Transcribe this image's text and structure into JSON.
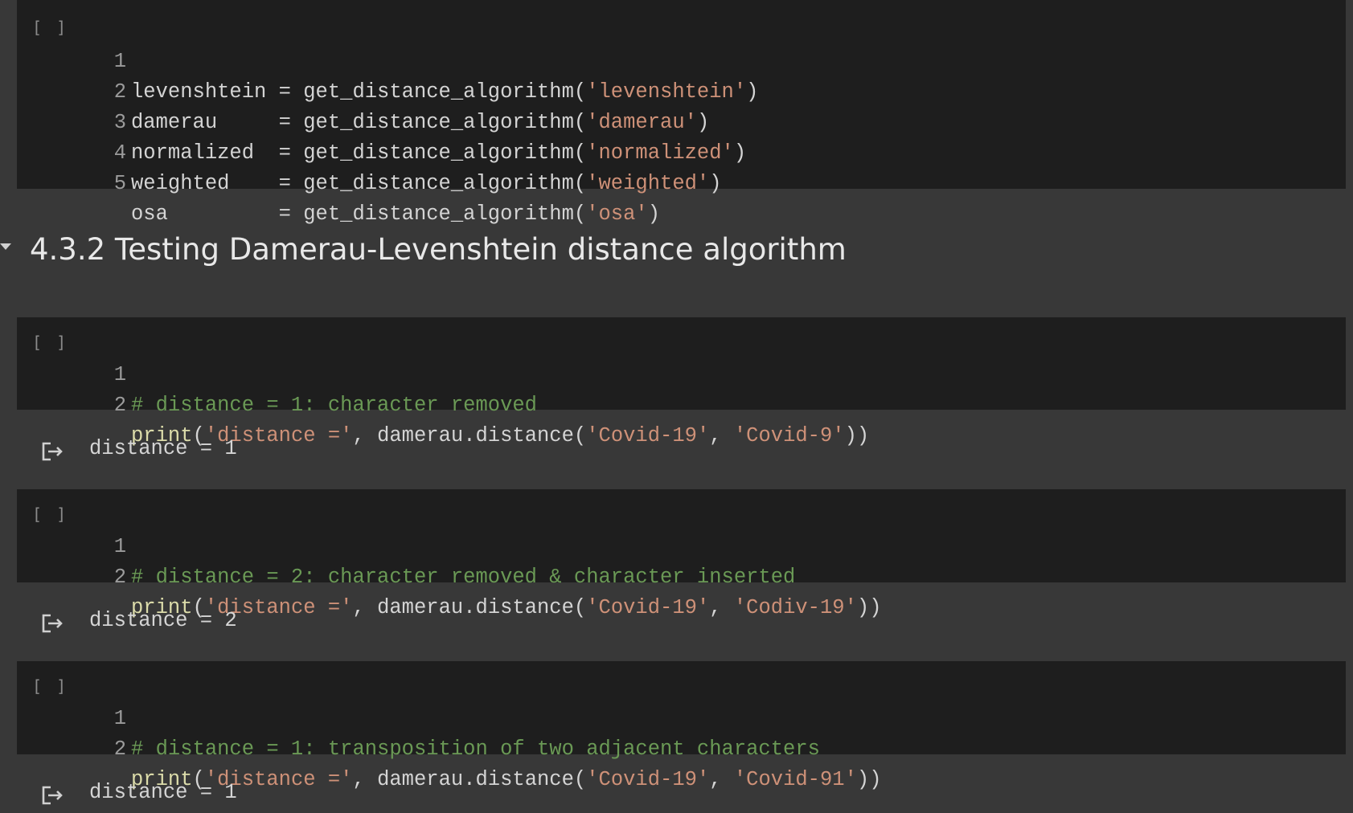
{
  "cells": [
    {
      "run_label": "[ ]",
      "lines": [
        {
          "n": "1",
          "parts": [
            {
              "t": "levenshtein = get_distance_algorithm(",
              "c": "plain"
            },
            {
              "t": "'levenshtein'",
              "c": "str"
            },
            {
              "t": ")",
              "c": "plain"
            }
          ]
        },
        {
          "n": "2",
          "parts": [
            {
              "t": "damerau     = get_distance_algorithm(",
              "c": "plain"
            },
            {
              "t": "'damerau'",
              "c": "str"
            },
            {
              "t": ")",
              "c": "plain"
            }
          ]
        },
        {
          "n": "3",
          "parts": [
            {
              "t": "normalized  = get_distance_algorithm(",
              "c": "plain"
            },
            {
              "t": "'normalized'",
              "c": "str"
            },
            {
              "t": ")",
              "c": "plain"
            }
          ]
        },
        {
          "n": "4",
          "parts": [
            {
              "t": "weighted    = get_distance_algorithm(",
              "c": "plain"
            },
            {
              "t": "'weighted'",
              "c": "str"
            },
            {
              "t": ")",
              "c": "plain"
            }
          ]
        },
        {
          "n": "5",
          "parts": [
            {
              "t": "osa         = get_distance_algorithm(",
              "c": "plain"
            },
            {
              "t": "'osa'",
              "c": "str"
            },
            {
              "t": ")",
              "c": "plain"
            }
          ]
        }
      ]
    },
    {
      "run_label": "[ ]",
      "lines": [
        {
          "n": "1",
          "parts": [
            {
              "t": "# distance = 1: character removed",
              "c": "cmt"
            }
          ]
        },
        {
          "n": "2",
          "parts": [
            {
              "t": "print",
              "c": "fn"
            },
            {
              "t": "(",
              "c": "plain"
            },
            {
              "t": "'distance ='",
              "c": "str"
            },
            {
              "t": ", damerau.distance(",
              "c": "plain"
            },
            {
              "t": "'Covid-19'",
              "c": "str"
            },
            {
              "t": ", ",
              "c": "plain"
            },
            {
              "t": "'Covid-9'",
              "c": "str"
            },
            {
              "t": "))",
              "c": "plain"
            }
          ]
        }
      ],
      "output": "distance = 1"
    },
    {
      "run_label": "[ ]",
      "lines": [
        {
          "n": "1",
          "parts": [
            {
              "t": "# distance = 2: character removed & character inserted",
              "c": "cmt"
            }
          ]
        },
        {
          "n": "2",
          "parts": [
            {
              "t": "print",
              "c": "fn"
            },
            {
              "t": "(",
              "c": "plain"
            },
            {
              "t": "'distance ='",
              "c": "str"
            },
            {
              "t": ", damerau.distance(",
              "c": "plain"
            },
            {
              "t": "'Covid-19'",
              "c": "str"
            },
            {
              "t": ", ",
              "c": "plain"
            },
            {
              "t": "'Codiv-19'",
              "c": "str"
            },
            {
              "t": "))",
              "c": "plain"
            }
          ]
        }
      ],
      "output": "distance = 2"
    },
    {
      "run_label": "[ ]",
      "lines": [
        {
          "n": "1",
          "parts": [
            {
              "t": "# distance = 1: transposition of two adjacent characters",
              "c": "cmt"
            }
          ]
        },
        {
          "n": "2",
          "parts": [
            {
              "t": "print",
              "c": "fn"
            },
            {
              "t": "(",
              "c": "plain"
            },
            {
              "t": "'distance ='",
              "c": "str"
            },
            {
              "t": ", damerau.distance(",
              "c": "plain"
            },
            {
              "t": "'Covid-19'",
              "c": "str"
            },
            {
              "t": ", ",
              "c": "plain"
            },
            {
              "t": "'Covid-91'",
              "c": "str"
            },
            {
              "t": "))",
              "c": "plain"
            }
          ]
        }
      ],
      "output": "distance = 1"
    }
  ],
  "section": {
    "title": "4.3.2 Testing Damerau-Levenshtein distance algorithm"
  },
  "colors": {
    "page_bg": "#383838",
    "cell_bg": "#1e1e1e",
    "string": "#ce9178",
    "comment": "#6a9955",
    "function": "#dcdcaa"
  },
  "icons": {
    "output": "output-arrow-icon",
    "toggle": "collapse-triangle-icon"
  }
}
